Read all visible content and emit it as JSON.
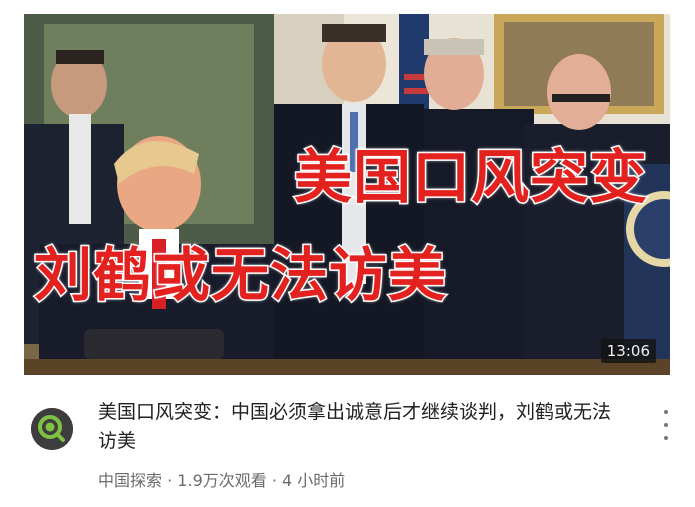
{
  "video": {
    "overlay_line1": "美国口风突变",
    "overlay_line2": "刘鹤或无法访美",
    "duration": "13:06",
    "title": "美国口风突变：中国必须拿出诚意后才继续谈判，刘鹤或无法访美",
    "channel": "中国探索",
    "separator": "·",
    "views": "1.9万次观看",
    "age": "4 小时前"
  },
  "colors": {
    "overlay_text": "#e3211f",
    "overlay_outline": "#ffffff",
    "avatar_ring": "#7fc241",
    "meta_text": "#6b6b6b"
  },
  "icons": {
    "channel_avatar": "magnifier-logo-icon",
    "more": "more-vertical-icon"
  }
}
